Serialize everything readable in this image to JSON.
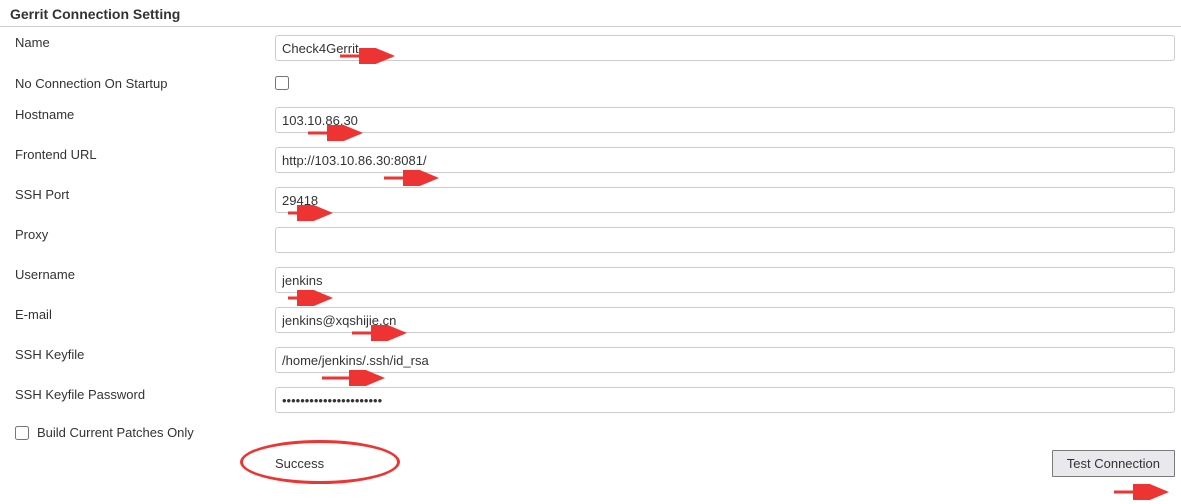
{
  "section_title": "Gerrit Connection Setting",
  "fields": {
    "name": {
      "label": "Name",
      "value": "Check4Gerrit"
    },
    "no_conn_startup": {
      "label": "No Connection On Startup",
      "checked": false
    },
    "hostname": {
      "label": "Hostname",
      "value": "103.10.86.30"
    },
    "frontend_url": {
      "label": "Frontend URL",
      "value": "http://103.10.86.30:8081/"
    },
    "ssh_port": {
      "label": "SSH Port",
      "value": "29418"
    },
    "proxy": {
      "label": "Proxy",
      "value": ""
    },
    "username": {
      "label": "Username",
      "value": "jenkins"
    },
    "email": {
      "label": "E-mail",
      "value": "jenkins@xqshijie.cn"
    },
    "ssh_keyfile": {
      "label": "SSH Keyfile",
      "value": "/home/jenkins/.ssh/id_rsa"
    },
    "ssh_keyfile_pw": {
      "label": "SSH Keyfile Password",
      "value": "••••••••••••••••••••••"
    },
    "build_current": {
      "label": "Build Current Patches Only",
      "checked": false
    }
  },
  "status": "Success",
  "test_button": "Test Connection",
  "annotations": {
    "arrow_color": "#e33"
  }
}
